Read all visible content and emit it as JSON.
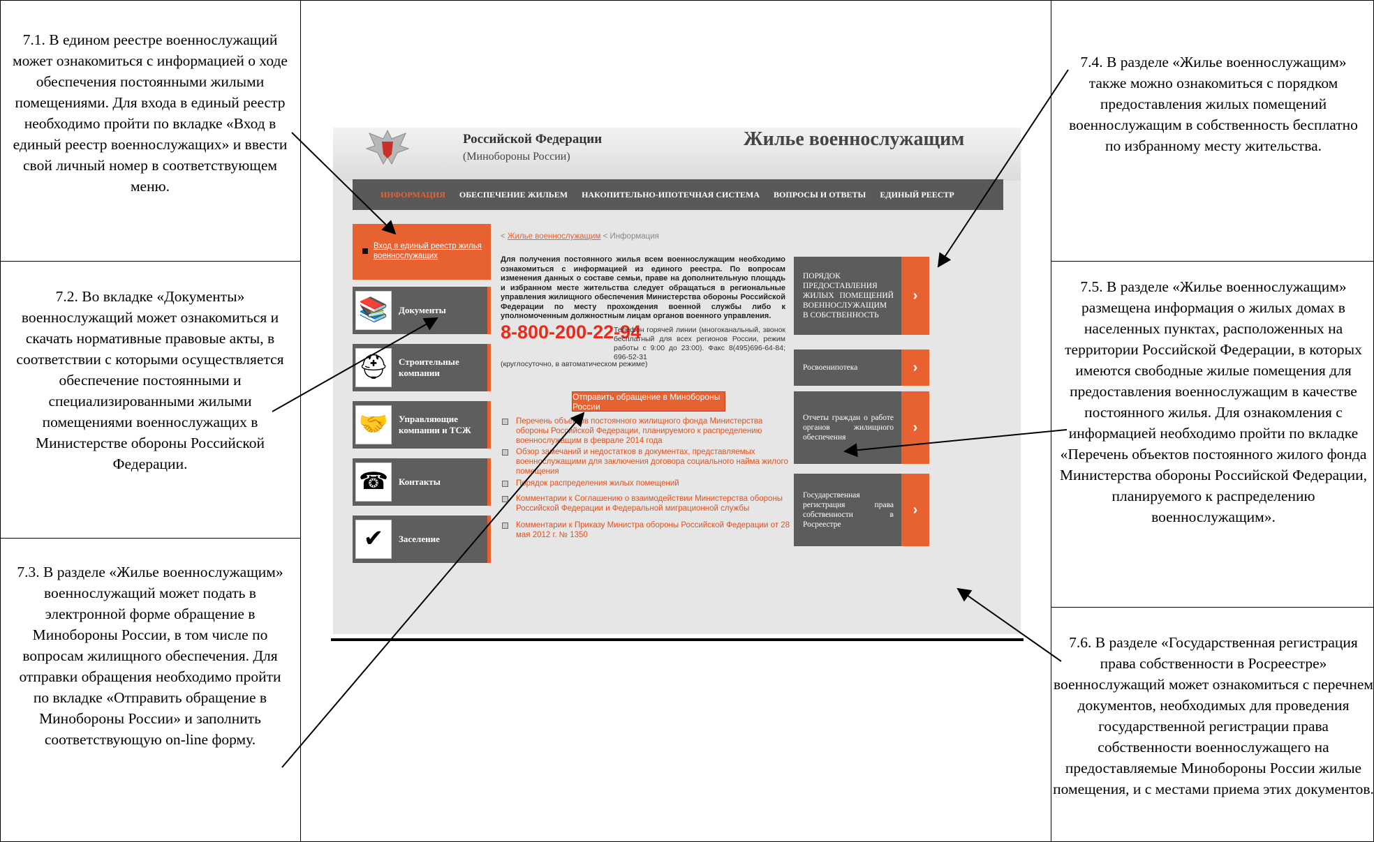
{
  "annotations": [
    "7.1. В едином реестре военнослужащий может ознакомиться с информацией о ходе обеспечения постоянными жилыми помещениями. Для входа в единый реестр необходимо пройти по вкладке «Вход в единый реестр военнослужащих» и ввести свой личный номер в соответствующем меню.",
    "7.2. Во вкладке «Документы» военнослужащий может ознакомиться и скачать нормативные правовые акты, в соответствии с которыми осуществляется обеспечение постоянными и специализированными жилыми помещениями военнослужащих в Министерстве обороны Российской Федерации.",
    "7.3. В разделе «Жилье военнослужащим» военнослужащий может подать в электронной форме обращение в Минобороны России, в том числе по вопросам жилищного обеспечения. Для отправки обращения необходимо пройти по вкладке «Отправить обращение в Минобороны России» и заполнить соответствующую on-line форму.",
    "7.4. В разделе «Жилье военнослужащим» также можно ознакомиться с порядком предоставления жилых помещений военнослужащим в собственность бесплатно по избранному месту жительства.",
    "7.5. В разделе «Жилье военнослужащим» размещена информация о жилых домах в населенных пунктах, расположенных на территории Российской Федерации, в которых имеются свободные жилые помещения для предоставления военнослужащим в качестве постоянного жилья. Для ознакомления с информацией необходимо пройти по вкладке «Перечень объектов постоянного жилого фонда Министерства обороны Российской Федерации, планируемого к распределению военнослужащим».",
    "7.6. В разделе «Государственная регистрация права собственности в Росреестре» военнослужащий может ознакомиться с перечнем документов, необходимых для проведения государственной регистрации права собственности военнослужащего на предоставляемые Минобороны России жилые помещения, и с местами приема этих документов."
  ],
  "site": {
    "org_line1": "Российской Федерации",
    "org_line2": "(Минобороны России)",
    "title": "Жилье военнослужащим",
    "nav": [
      "ИНФОРМАЦИЯ",
      "ОБЕСПЕЧЕНИЕ ЖИЛЬЕМ",
      "НАКОПИТЕЛЬНО-ИПОТЕЧНАЯ СИСТЕМА",
      "ВОПРОСЫ И ОТВЕТЫ",
      "ЕДИНЫЙ РЕЕСТР"
    ],
    "registry_link": "Вход в единый реестр жилья военнослужащих",
    "side_buttons": [
      "Документы",
      "Строительные компании",
      "Управляющие компании и ТСЖ",
      "Контакты",
      "Заселение"
    ],
    "breadcrumb_link": "Жилье военнослужащим",
    "breadcrumb_current": "< Информация",
    "intro": "Для получения постоянного жилья всем военнослужащим необходимо ознакомиться с информацией из единого реестра. По вопросам изменения данных о составе семьи, праве на дополнительную площадь и избранном месте жительства следует обращаться в региональные управления жилищного обеспечения Министерства обороны Российской Федерации по месту прохождения военной службы либо к уполномоченным должностным лицам органов военного управления.",
    "phone": "8-800-200-22-94",
    "hotline": "Телефон горячей линии (многоканальный, звонок бесплатный для всех регионов России, режим работы с 9:00 до 23:00). Факс 8(495)696-64-84; 696-52-31",
    "hotline_tail": "(круглосуточно, в автоматическом режиме)",
    "send_button": "Отправить обращение в Минобороны России",
    "links": [
      "Перечень объектов постоянного жилищного фонда Министерства обороны Российской Федерации, планируемого к распределению военнослужащим в феврале 2014 года",
      "Обзор замечаний и недостатков в документах, представляемых военнослужащими для заключения договора социального найма жилого помещения",
      "Порядок распределения жилых помещений",
      "Комментарии к Соглашению о взаимодействии Министерства обороны Российской Федерации и Федеральной миграционной службы",
      "Комментарии к Приказу Министра обороны Российской Федерации от 28 мая 2012 г. № 1350"
    ],
    "right_buttons": [
      "ПОРЯДОК ПРЕДОСТАВЛЕНИЯ ЖИЛЫХ ПОМЕЩЕНИЙ ВОЕННОСЛУЖАЩИМ В СОБСТВЕННОСТЬ",
      "Росвоенипотека",
      "Отчеты граждан о работе органов жилищного обеспечения",
      "Государственная регистрация права собственности в Росреестре"
    ]
  }
}
